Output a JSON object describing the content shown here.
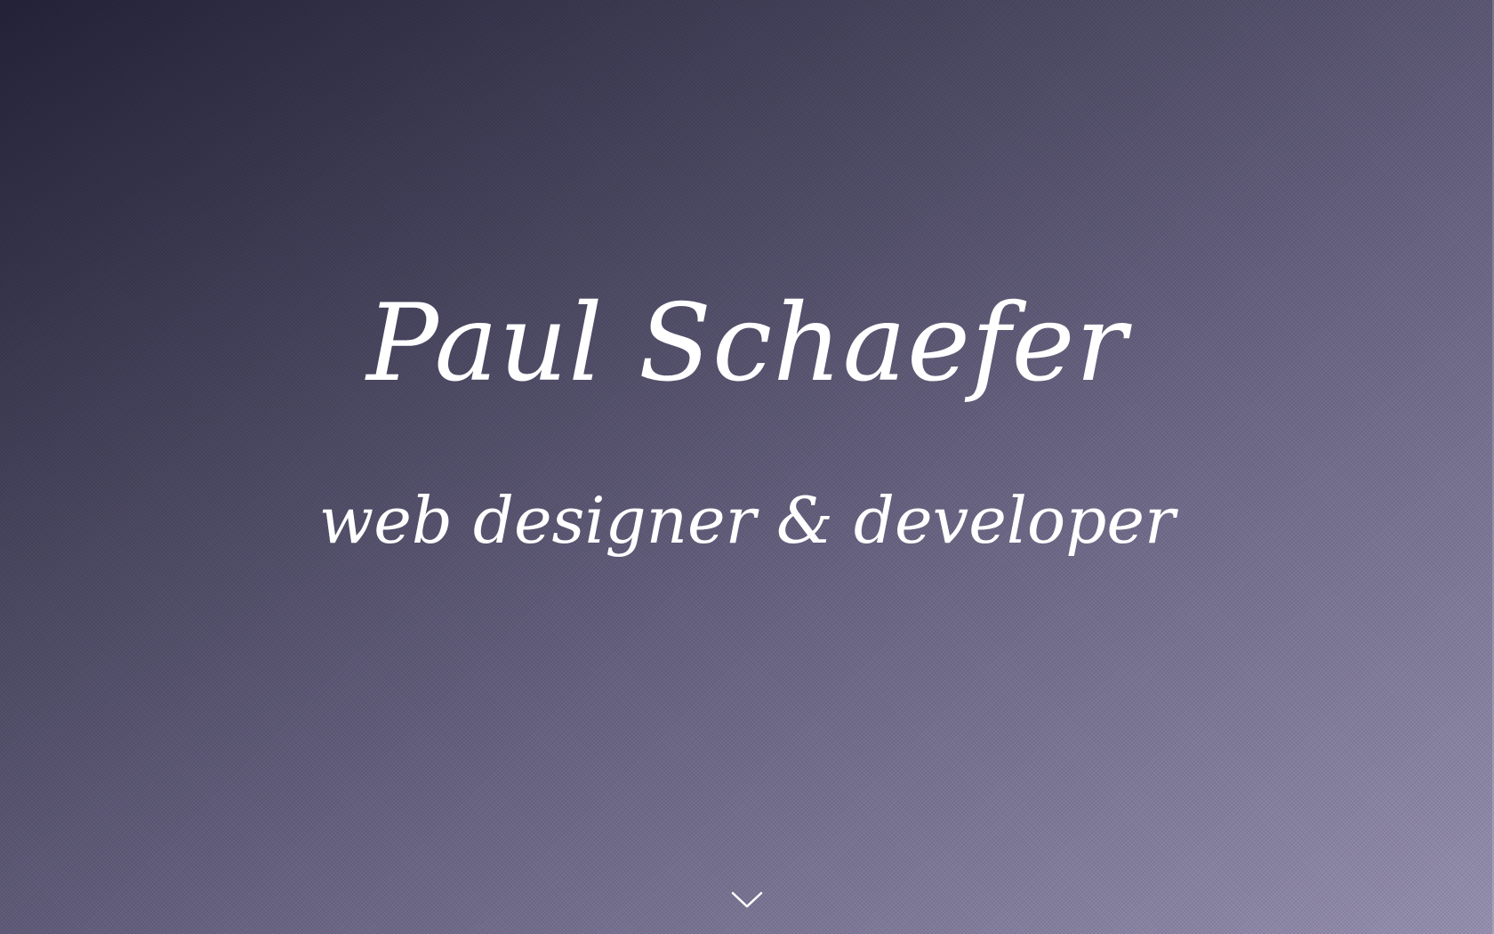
{
  "hero": {
    "title": "Paul Schaefer",
    "subtitle": "web designer & developer",
    "scroll_icon": "chevron-down-icon"
  },
  "colors": {
    "gradient_dark": "#24233a",
    "gradient_light": "#9a94b4",
    "text": "#ffffff"
  }
}
